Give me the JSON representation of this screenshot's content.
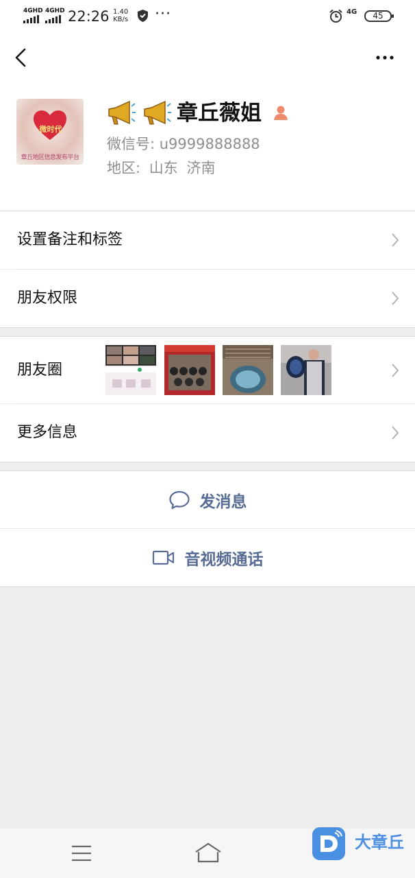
{
  "status_bar": {
    "signal_1": "4GHD",
    "signal_2": "4GHD",
    "time": "22:26",
    "speed_value": "1.40",
    "speed_unit": "KB/s",
    "network": "4G",
    "battery": "45"
  },
  "profile": {
    "name": "章丘薇姐",
    "wechat_id": "微信号: u9999888888",
    "region_label": "地区:",
    "region_province": "山东",
    "region_city": "济南",
    "avatar_brand": "微时代",
    "avatar_slogan": "章丘地区信息发布平台"
  },
  "menu": {
    "remark_tags": "设置备注和标签",
    "friend_permissions": "朋友权限",
    "moments": "朋友圈",
    "more_info": "更多信息"
  },
  "actions": {
    "send_message": "发消息",
    "video_call": "音视频通话"
  },
  "watermark": {
    "text": "大章丘"
  },
  "colors": {
    "link_blue": "#576b95",
    "secondary_text": "#8e8e8e",
    "background": "#ededed"
  }
}
